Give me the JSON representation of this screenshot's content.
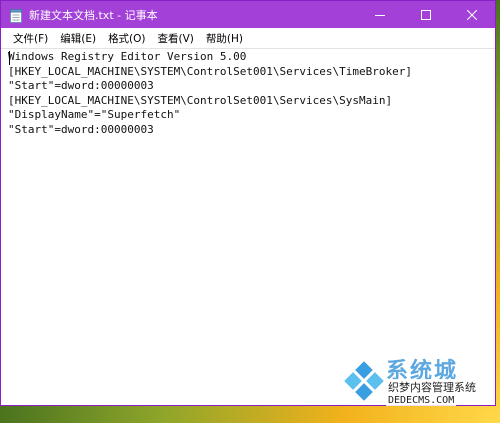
{
  "window": {
    "title": "新建文本文档.txt - 记事本"
  },
  "menu": {
    "items": [
      "文件(F)",
      "编辑(E)",
      "格式(O)",
      "查看(V)",
      "帮助(H)"
    ]
  },
  "editor": {
    "lines": [
      "Windows Registry Editor Version 5.00",
      "[HKEY_LOCAL_MACHINE\\SYSTEM\\ControlSet001\\Services\\TimeBroker]",
      "\"Start\"=dword:00000003",
      "[HKEY_LOCAL_MACHINE\\SYSTEM\\ControlSet001\\Services\\SysMain]",
      "\"DisplayName\"=\"Superfetch\"",
      "\"Start\"=dword:00000003"
    ]
  },
  "watermark": {
    "big": "系统城",
    "mid": "织梦内容管理系统",
    "url": "DEDECMS.COM"
  },
  "colors": {
    "titlebar": "#a240d8",
    "accent_border": "#8a1fc4"
  }
}
